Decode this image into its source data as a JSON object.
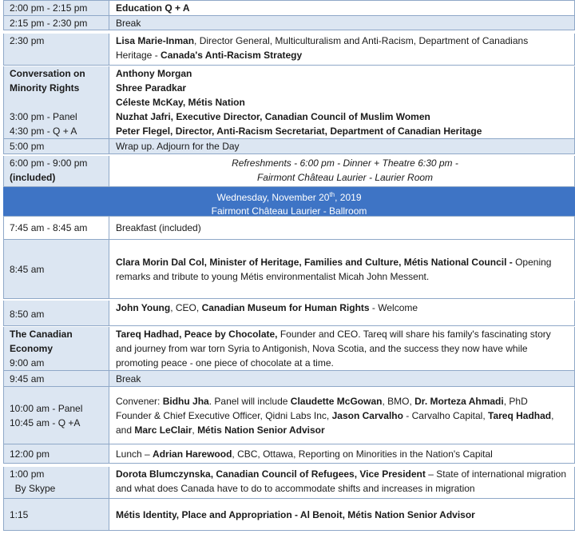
{
  "rows": [
    {
      "time": "2:00 pm - 2:15 pm",
      "content": "Education Q + A"
    },
    {
      "time": "2:15 pm - 2:30 pm",
      "content": "Break"
    },
    {
      "time": "2:30 pm",
      "line1": {
        "name": "Lisa Marie-Inman",
        "rest": ", Director General, Multiculturalism and Anti-Racism, Department of Canadians"
      },
      "line2": {
        "rest": "Heritage - ",
        "bold": "Canada's Anti-Racism Strategy"
      }
    },
    {
      "time_lines": [
        "Conversation on",
        "Minority Rights",
        "",
        "3:00 pm - Panel",
        "4:30 pm - Q + A"
      ],
      "speakers": [
        "Anthony Morgan",
        "Shree Paradkar",
        "Céleste McKay, Métis Nation",
        "Nuzhat Jafri, Executive Director, Canadian Council of Muslim Women",
        "Peter Flegel, Director, Anti-Racism Secretariat, Department of Canadian Heritage"
      ]
    },
    {
      "time": "5:00 pm",
      "content": "Wrap up.  Adjourn for the Day"
    },
    {
      "time_lines": [
        "6:00 pm - 9:00 pm",
        "(included)"
      ],
      "lines": [
        "Refreshments - 6:00 pm - Dinner + Theatre 6:30 pm -",
        "Fairmont Château Laurier - Laurier Room"
      ]
    }
  ],
  "day_header": {
    "line1": "Wednesday, November 20",
    "sup": "th",
    "line1_end": ", 2019",
    "line2": "Fairmont Château Laurier - Ballroom"
  },
  "rows2": [
    {
      "time": "7:45 am - 8:45 am",
      "content": "Breakfast (included)"
    },
    {
      "time": "8:45 am",
      "l1_bold": "Clara Morin Dal Col, Minister of Heritage, Families and Culture, Métis National Council -",
      "l1_rest": " Opening",
      "l2": "remarks and tribute to young Métis environmentalist Micah John Messent."
    },
    {
      "time": "8:50 am",
      "a": "John Young",
      "b": ", CEO, ",
      "c": "Canadian Museum for Human Rights",
      "d": " - Welcome"
    },
    {
      "time_lines": [
        "The Canadian",
        "Economy",
        "9:00 am"
      ],
      "l1_bold": "Tareq Hadhad, Peace by Chocolate,",
      "l1_rest": " Founder and CEO. Tareq will share his family's fascinating story",
      "l2": "and journey from war torn Syria to Antigonish, Nova Scotia, and the success they now have while",
      "l3": "promoting peace - one piece of chocolate at a time."
    },
    {
      "time": "9:45 am",
      "content": "Break"
    },
    {
      "time_lines": [
        "10:00 am - Panel",
        "10:45 am - Q +A"
      ],
      "l1": [
        [
          "Convener: ",
          false
        ],
        [
          "Bidhu Jha",
          true
        ],
        [
          ". Panel will include ",
          false
        ],
        [
          "Claudette McGowan",
          true
        ],
        [
          ", BMO, ",
          false
        ],
        [
          "Dr. Morteza Ahmadi",
          true
        ],
        [
          ", PhD",
          false
        ]
      ],
      "l2": [
        [
          "Founder & Chief Executive Officer, Qidni Labs Inc, ",
          false
        ],
        [
          "Jason Carvalho",
          true
        ],
        [
          " - Carvalho Capital, ",
          false
        ],
        [
          "Tareq Hadhad",
          true
        ],
        [
          ",",
          false
        ]
      ],
      "l3": [
        [
          "and ",
          false
        ],
        [
          "Marc LeClair",
          true
        ],
        [
          ", ",
          false
        ],
        [
          "Métis Nation Senior Advisor",
          true
        ]
      ]
    },
    {
      "time": "12:00 pm",
      "l1": [
        [
          "Lunch – ",
          false
        ],
        [
          "Adrian Harewood",
          true
        ],
        [
          ", CBC, Ottawa, Reporting on Minorities in the Nation's Capital",
          false
        ]
      ]
    },
    {
      "time_lines": [
        "1:00 pm",
        "  By Skype"
      ],
      "l1": [
        [
          "Dorota Blumczynska, Canadian Council of Refugees, Vice President",
          true
        ],
        [
          " – State of international migration",
          false
        ]
      ],
      "l2": [
        [
          "and what does Canada have to do to accommodate shifts and increases in migration",
          false
        ]
      ]
    },
    {
      "time": "1:15",
      "content": "Métis Identity, Place and Appropriation - Al Benoit, Métis Nation Senior Advisor"
    }
  ]
}
